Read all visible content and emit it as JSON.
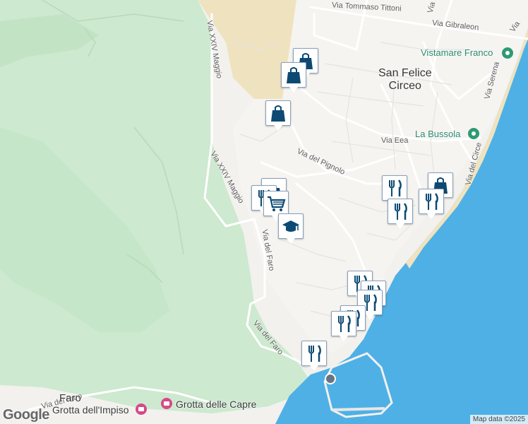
{
  "map": {
    "streets": [
      "Via Tommaso Tittoni",
      "Via Gibraleon",
      "Via T",
      "Via XXIV Maggio",
      "Via Eea",
      "Via del Pignolo",
      "Via XXIV Maggio",
      "Via del Faro",
      "Via del Faro",
      "Via del Faro",
      "Via Serena",
      "Via del Circe",
      "Via"
    ],
    "town": "San Felice\nCirceo",
    "places": [
      {
        "name": "Vistamare Franco",
        "kind": "green-poi"
      },
      {
        "name": "La Bussola",
        "kind": "green-poi"
      },
      {
        "name": "Grotta dell'Impiso",
        "kind": "photo-poi"
      },
      {
        "name": "Grotta delle Capre",
        "kind": "photo-poi"
      },
      {
        "name": "Faro",
        "kind": "place"
      }
    ],
    "markers": [
      {
        "type": "shopping-bag-icon"
      },
      {
        "type": "shopping-bag-icon"
      },
      {
        "type": "shopping-bag-icon"
      },
      {
        "type": "shopping-bag-icon"
      },
      {
        "type": "restaurant-icon"
      },
      {
        "type": "shopping-cart-icon"
      },
      {
        "type": "school-icon"
      },
      {
        "type": "restaurant-icon"
      },
      {
        "type": "restaurant-icon"
      },
      {
        "type": "restaurant-icon"
      },
      {
        "type": "restaurant-icon"
      },
      {
        "type": "restaurant-icon"
      },
      {
        "type": "restaurant-icon"
      },
      {
        "type": "restaurant-icon"
      },
      {
        "type": "restaurant-icon"
      },
      {
        "type": "restaurant-icon"
      }
    ],
    "logo": "Google",
    "attribution": "Map data ©2025",
    "colors": {
      "sea": "#4fb0e6",
      "park": "#cde9cf",
      "land": "#f2f1ee",
      "sand": "#efe3bf",
      "marker_icon": "#0d4a73"
    }
  }
}
